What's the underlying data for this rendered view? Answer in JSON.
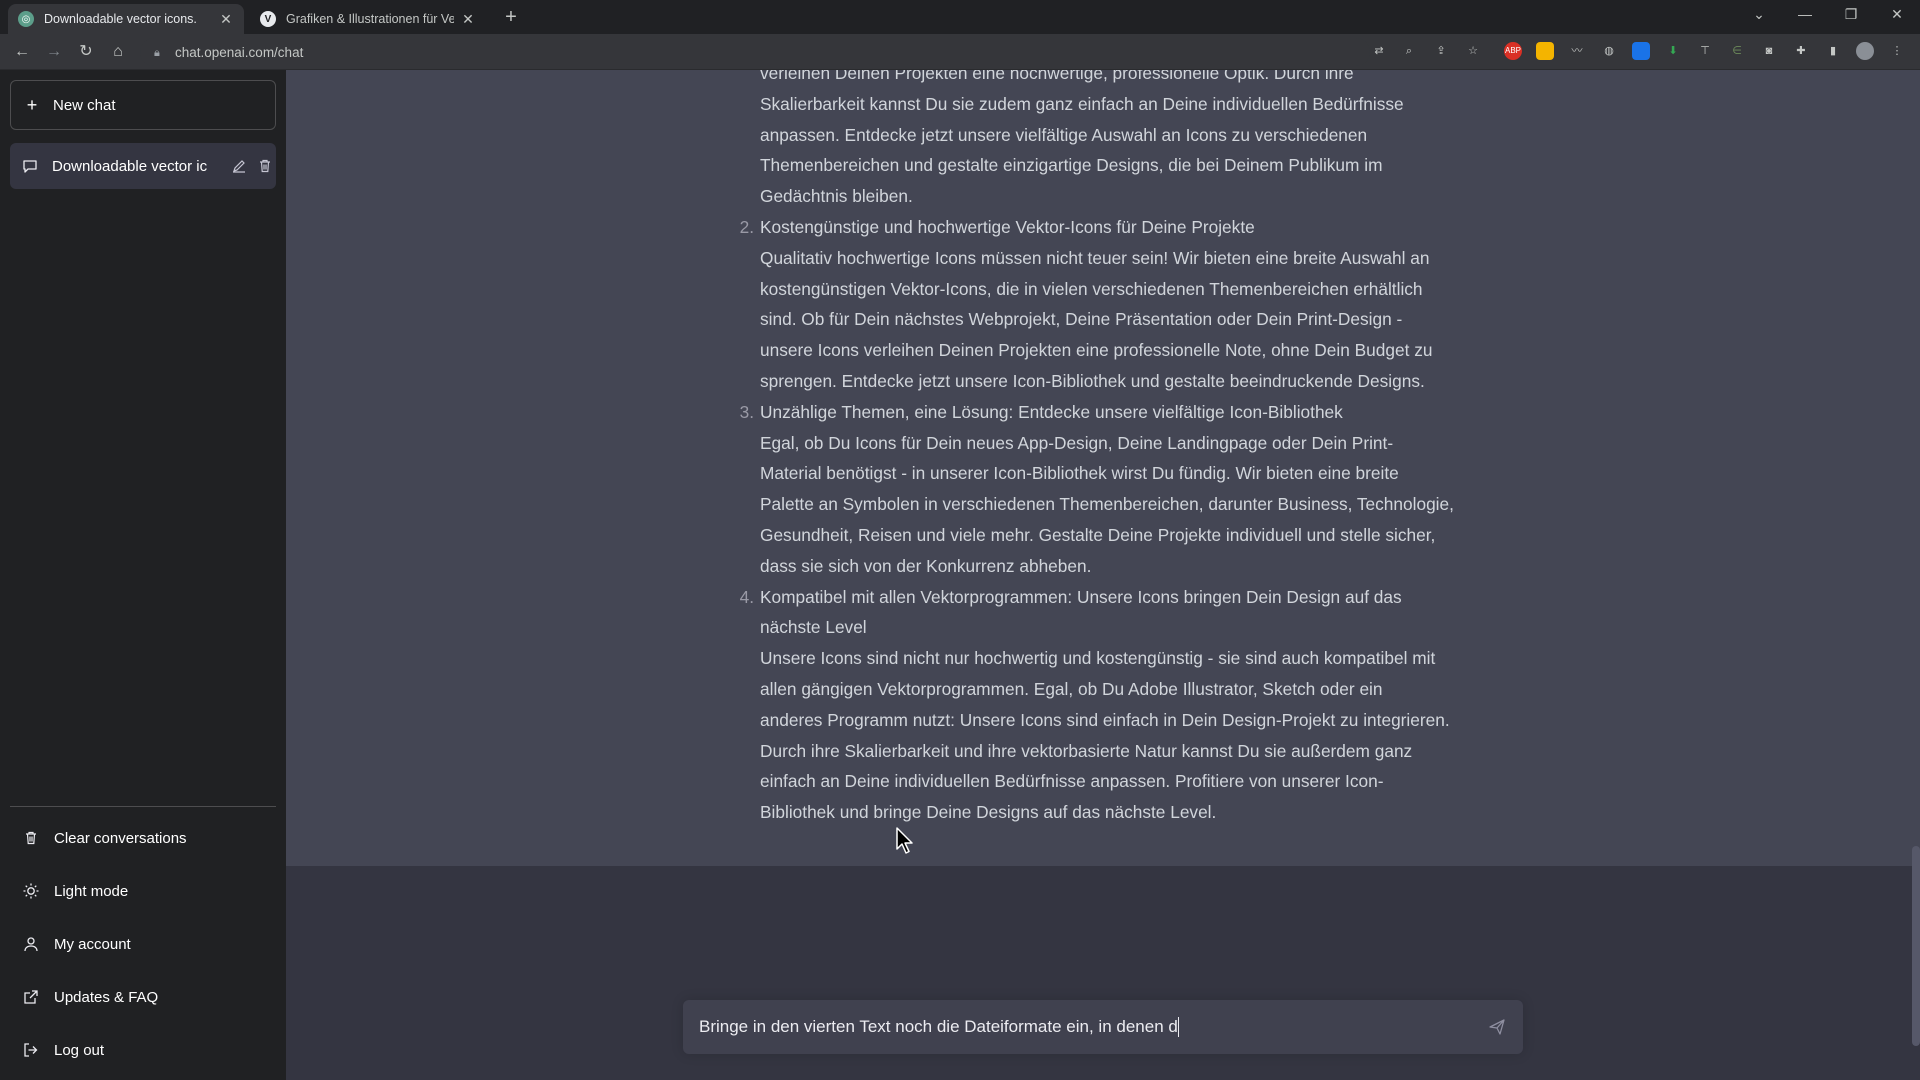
{
  "browser": {
    "tabs": [
      {
        "title": "Downloadable vector icons.",
        "active": true
      },
      {
        "title": "Grafiken & Illustrationen für Vekt",
        "active": false
      }
    ],
    "url": "chat.openai.com/chat"
  },
  "sidebar": {
    "new_chat": "New chat",
    "conversation": "Downloadable vector ic",
    "items": [
      {
        "label": "Clear conversations",
        "icon": "trash-icon"
      },
      {
        "label": "Light mode",
        "icon": "sun-icon"
      },
      {
        "label": "My account",
        "icon": "user-icon"
      },
      {
        "label": "Updates & FAQ",
        "icon": "external-link-icon"
      },
      {
        "label": "Log out",
        "icon": "logout-icon"
      }
    ]
  },
  "message": {
    "intro_lines": [
      "verleihen Deinen Projekten eine hochwertige, professionelle Optik. Durch ihre",
      "Skalierbarkeit kannst Du sie zudem ganz einfach an Deine individuellen Bedürfnisse",
      "anpassen. Entdecke jetzt unsere vielfältige Auswahl an Icons zu verschiedenen",
      "Themenbereichen und gestalte einzigartige Designs, die bei Deinem Publikum im",
      "Gedächtnis bleiben."
    ],
    "items": [
      {
        "number": "2.",
        "heading": "Kostengünstige und hochwertige Vektor-Icons für Deine Projekte",
        "lines": [
          "Qualitativ hochwertige Icons müssen nicht teuer sein! Wir bieten eine breite Auswahl an",
          "kostengünstigen Vektor-Icons, die in vielen verschiedenen Themenbereichen erhältlich",
          "sind. Ob für Dein nächstes Webprojekt, Deine Präsentation oder Dein Print-Design -",
          "unsere Icons verleihen Deinen Projekten eine professionelle Note, ohne Dein Budget zu",
          "sprengen. Entdecke jetzt unsere Icon-Bibliothek und gestalte beeindruckende Designs."
        ]
      },
      {
        "number": "3.",
        "heading": "Unzählige Themen, eine Lösung: Entdecke unsere vielfältige Icon-Bibliothek",
        "lines": [
          "Egal, ob Du Icons für Dein neues App-Design, Deine Landingpage oder Dein Print-",
          "Material benötigst - in unserer Icon-Bibliothek wirst Du fündig. Wir bieten eine breite",
          "Palette an Symbolen in verschiedenen Themenbereichen, darunter Business, Technologie,",
          "Gesundheit, Reisen und viele mehr. Gestalte Deine Projekte individuell und stelle sicher,",
          "dass sie sich von der Konkurrenz abheben."
        ]
      },
      {
        "number": "4.",
        "heading_lines": [
          "Kompatibel mit allen Vektorprogrammen: Unsere Icons bringen Dein Design auf das",
          "nächste Level"
        ],
        "lines": [
          "Unsere Icons sind nicht nur hochwertig und kostengünstig - sie sind auch kompatibel mit",
          "allen gängigen Vektorprogrammen. Egal, ob Du Adobe Illustrator, Sketch oder ein",
          "anderes Programm nutzt: Unsere Icons sind einfach in Dein Design-Projekt zu integrieren.",
          "Durch ihre Skalierbarkeit und ihre vektorbasierte Natur kannst Du sie außerdem ganz",
          "einfach an Deine individuellen Bedürfnisse anpassen. Profitiere von unserer Icon-",
          "Bibliothek und bringe Deine Designs auf das nächste Level."
        ]
      }
    ]
  },
  "composer": {
    "value": "Bringe in den vierten Text noch die Dateiformate ein, in denen d"
  }
}
